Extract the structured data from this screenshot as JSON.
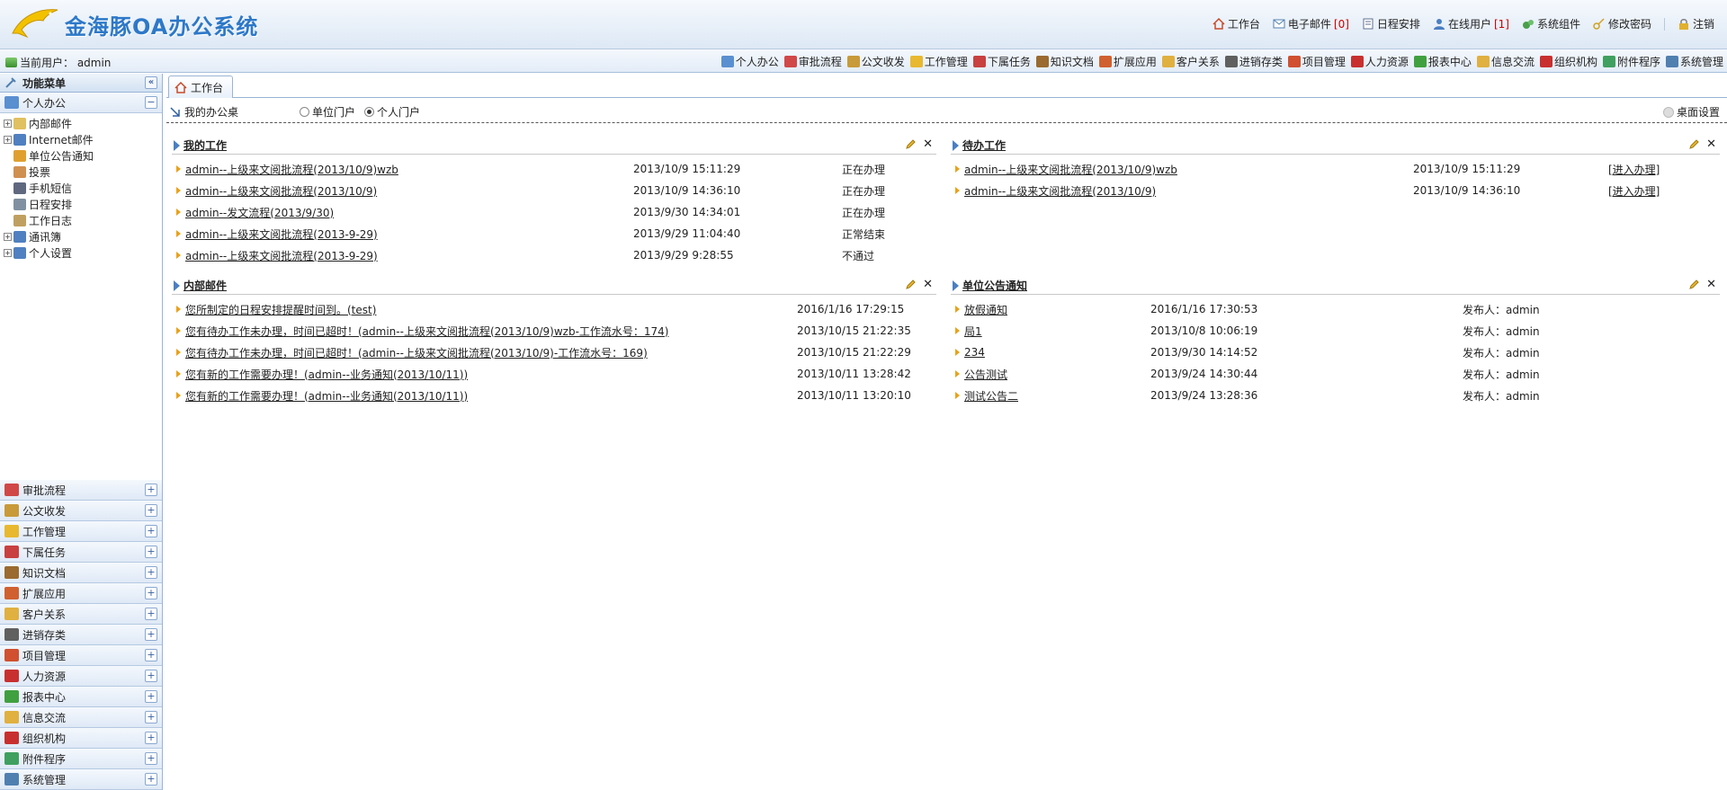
{
  "app": {
    "title": "金海豚OA办公系统"
  },
  "toplinks": [
    {
      "label": "工作台",
      "icon": "home-icon"
    },
    {
      "label": "电子邮件",
      "count": "[0]",
      "icon": "mail-icon"
    },
    {
      "label": "日程安排",
      "icon": "calendar-icon"
    },
    {
      "label": "在线用户",
      "count": "[1]",
      "icon": "user-icon"
    },
    {
      "label": "系统组件",
      "icon": "puzzle-icon"
    },
    {
      "label": "修改密码",
      "icon": "key-icon"
    },
    {
      "label": "注销",
      "icon": "lock-icon"
    }
  ],
  "current_user": {
    "text": "当前用户：  admin"
  },
  "modnav": [
    {
      "label": "个人办公",
      "color": "#5a8fd0"
    },
    {
      "label": "审批流程",
      "color": "#d04848"
    },
    {
      "label": "公文收发",
      "color": "#c89a3a"
    },
    {
      "label": "工作管理",
      "color": "#e8b830"
    },
    {
      "label": "下属任务",
      "color": "#c84040"
    },
    {
      "label": "知识文档",
      "color": "#9a6a30"
    },
    {
      "label": "扩展应用",
      "color": "#d06030"
    },
    {
      "label": "客户关系",
      "color": "#e0b040"
    },
    {
      "label": "进销存类",
      "color": "#606060"
    },
    {
      "label": "项目管理",
      "color": "#d05030"
    },
    {
      "label": "人力资源",
      "color": "#c83030"
    },
    {
      "label": "报表中心",
      "color": "#40a040"
    },
    {
      "label": "信息交流",
      "color": "#e0b040"
    },
    {
      "label": "组织机构",
      "color": "#c83030"
    },
    {
      "label": "附件程序",
      "color": "#40a060"
    },
    {
      "label": "系统管理",
      "color": "#5080b0"
    }
  ],
  "sidebar": {
    "title": "功能菜单",
    "collapse_label": "«",
    "active_panel": "个人办公",
    "active_toggle": "−",
    "tree": [
      {
        "label": "内部邮件",
        "expand": true,
        "color": "#e0c060"
      },
      {
        "label": "Internet邮件",
        "expand": true,
        "color": "#5080c0"
      },
      {
        "label": "单位公告通知",
        "expand": false,
        "color": "#e0a030"
      },
      {
        "label": "投票",
        "expand": false,
        "color": "#d09050"
      },
      {
        "label": "手机短信",
        "expand": false,
        "color": "#606880"
      },
      {
        "label": "日程安排",
        "expand": false,
        "color": "#8090a0"
      },
      {
        "label": "工作日志",
        "expand": false,
        "color": "#c0a060"
      },
      {
        "label": "通讯簿",
        "expand": true,
        "color": "#5080c0"
      },
      {
        "label": "个人设置",
        "expand": true,
        "color": "#5080c0"
      }
    ],
    "panels": [
      {
        "label": "审批流程",
        "color": "#d04848"
      },
      {
        "label": "公文收发",
        "color": "#c89a3a"
      },
      {
        "label": "工作管理",
        "color": "#e8b830"
      },
      {
        "label": "下属任务",
        "color": "#c84040"
      },
      {
        "label": "知识文档",
        "color": "#9a6a30"
      },
      {
        "label": "扩展应用",
        "color": "#d06030"
      },
      {
        "label": "客户关系",
        "color": "#e0b040"
      },
      {
        "label": "进销存类",
        "color": "#606060"
      },
      {
        "label": "项目管理",
        "color": "#d05030"
      },
      {
        "label": "人力资源",
        "color": "#c83030"
      },
      {
        "label": "报表中心",
        "color": "#40a040"
      },
      {
        "label": "信息交流",
        "color": "#e0b040"
      },
      {
        "label": "组织机构",
        "color": "#c83030"
      },
      {
        "label": "附件程序",
        "color": "#40a060"
      },
      {
        "label": "系统管理",
        "color": "#5080b0"
      }
    ],
    "panel_toggle": "+"
  },
  "main": {
    "tab": "工作台",
    "mydesk": "我的办公桌",
    "radios": [
      {
        "label": "单位门户",
        "checked": false
      },
      {
        "label": "个人门户",
        "checked": true
      }
    ],
    "desk_settings": "桌面设置",
    "boxes": {
      "mywork": {
        "title": "我的工作",
        "rows": [
          {
            "title": "admin--上级来文阅批流程(2013/10/9)wzb",
            "time": "2013/10/9 15:11:29",
            "status": "正在办理"
          },
          {
            "title": "admin--上级来文阅批流程(2013/10/9)",
            "time": "2013/10/9 14:36:10",
            "status": "正在办理"
          },
          {
            "title": "admin--发文流程(2013/9/30)",
            "time": "2013/9/30 14:34:01",
            "status": "正在办理"
          },
          {
            "title": "admin--上级来文阅批流程(2013-9-29)",
            "time": "2013/9/29 11:04:40",
            "status": "正常结束"
          },
          {
            "title": "admin--上级来文阅批流程(2013-9-29)",
            "time": "2013/9/29 9:28:55",
            "status": "不通过"
          }
        ]
      },
      "todo": {
        "title": "待办工作",
        "rows": [
          {
            "title": "admin--上级来文阅批流程(2013/10/9)wzb",
            "time": "2013/10/9 15:11:29",
            "action": "[进入办理]"
          },
          {
            "title": "admin--上级来文阅批流程(2013/10/9)",
            "time": "2013/10/9 14:36:10",
            "action": "[进入办理]"
          }
        ]
      },
      "mail": {
        "title": "内部邮件",
        "rows": [
          {
            "title": "您所制定的日程安排提醒时间到。(test)",
            "time": "2016/1/16 17:29:15"
          },
          {
            "title": "您有待办工作未办理，时间已超时！(admin--上级来文阅批流程(2013/10/9)wzb-工作流水号：174)",
            "time": "2013/10/15 21:22:35"
          },
          {
            "title": "您有待办工作未办理，时间已超时！(admin--上级来文阅批流程(2013/10/9)-工作流水号：169)",
            "time": "2013/10/15 21:22:29"
          },
          {
            "title": "您有新的工作需要办理！(admin--业务通知(2013/10/11))",
            "time": "2013/10/11 13:28:42"
          },
          {
            "title": "您有新的工作需要办理！(admin--业务通知(2013/10/11))",
            "time": "2013/10/11 13:20:10"
          }
        ]
      },
      "notice": {
        "title": "单位公告通知",
        "rows": [
          {
            "title": "放假通知",
            "time": "2016/1/16 17:30:53",
            "publisher": "发布人：admin"
          },
          {
            "title": "局1",
            "time": "2013/10/8 10:06:19",
            "publisher": "发布人：admin"
          },
          {
            "title": "234",
            "time": "2013/9/30 14:14:52",
            "publisher": "发布人：admin"
          },
          {
            "title": "公告测试",
            "time": "2013/9/24 14:30:44",
            "publisher": "发布人：admin"
          },
          {
            "title": "测试公告二",
            "time": "2013/9/24 13:28:36",
            "publisher": "发布人：admin"
          }
        ]
      }
    },
    "close_glyph": "✕"
  }
}
